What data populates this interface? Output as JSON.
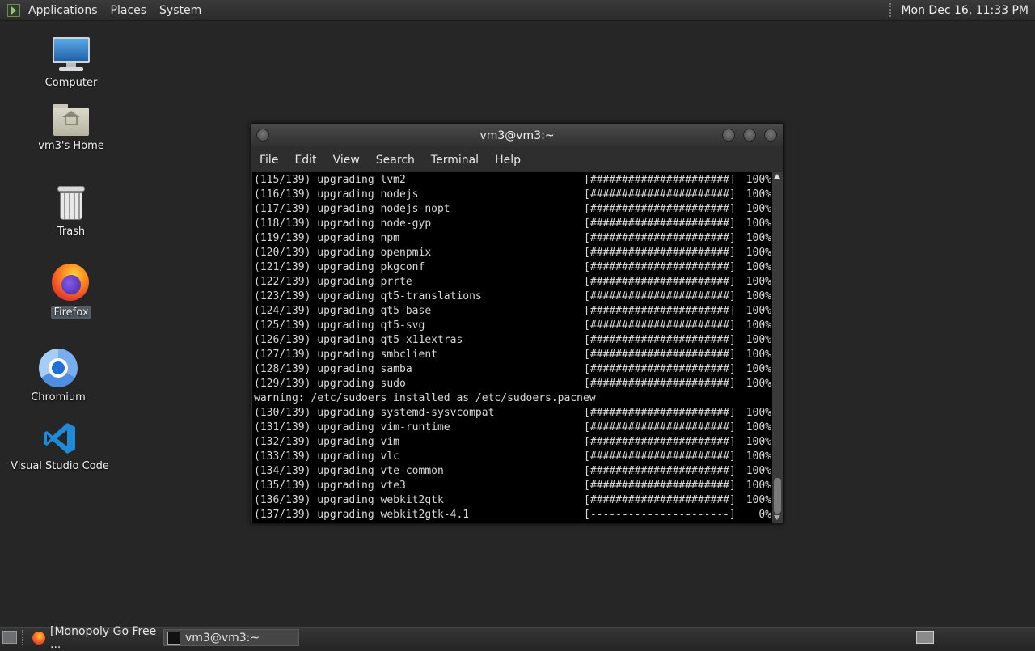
{
  "top_panel": {
    "menu": [
      "Applications",
      "Places",
      "System"
    ],
    "clock": "Mon Dec 16, 11:33 PM"
  },
  "desktop_icons": [
    {
      "label": "Computer",
      "icon": "computer-icon"
    },
    {
      "label": "vm3's Home",
      "icon": "home-folder-icon"
    },
    {
      "label": "Trash",
      "icon": "trash-icon"
    },
    {
      "label": "Firefox",
      "icon": "firefox-icon"
    },
    {
      "label": "Chromium",
      "icon": "chromium-icon"
    },
    {
      "label": "Visual Studio Code",
      "icon": "vscode-icon"
    }
  ],
  "terminal": {
    "title": "vm3@vm3:~",
    "menu": [
      "File",
      "Edit",
      "View",
      "Search",
      "Terminal",
      "Help"
    ],
    "lines": [
      {
        "text": "(115/139) upgrading lvm2",
        "bar": "[######################]",
        "pct": "100%"
      },
      {
        "text": "(116/139) upgrading nodejs",
        "bar": "[######################]",
        "pct": "100%"
      },
      {
        "text": "(117/139) upgrading nodejs-nopt",
        "bar": "[######################]",
        "pct": "100%"
      },
      {
        "text": "(118/139) upgrading node-gyp",
        "bar": "[######################]",
        "pct": "100%"
      },
      {
        "text": "(119/139) upgrading npm",
        "bar": "[######################]",
        "pct": "100%"
      },
      {
        "text": "(120/139) upgrading openpmix",
        "bar": "[######################]",
        "pct": "100%"
      },
      {
        "text": "(121/139) upgrading pkgconf",
        "bar": "[######################]",
        "pct": "100%"
      },
      {
        "text": "(122/139) upgrading prrte",
        "bar": "[######################]",
        "pct": "100%"
      },
      {
        "text": "(123/139) upgrading qt5-translations",
        "bar": "[######################]",
        "pct": "100%"
      },
      {
        "text": "(124/139) upgrading qt5-base",
        "bar": "[######################]",
        "pct": "100%"
      },
      {
        "text": "(125/139) upgrading qt5-svg",
        "bar": "[######################]",
        "pct": "100%"
      },
      {
        "text": "(126/139) upgrading qt5-x11extras",
        "bar": "[######################]",
        "pct": "100%"
      },
      {
        "text": "(127/139) upgrading smbclient",
        "bar": "[######################]",
        "pct": "100%"
      },
      {
        "text": "(128/139) upgrading samba",
        "bar": "[######################]",
        "pct": "100%"
      },
      {
        "text": "(129/139) upgrading sudo",
        "bar": "[######################]",
        "pct": "100%"
      },
      {
        "text": "warning: /etc/sudoers installed as /etc/sudoers.pacnew",
        "bar": "",
        "pct": ""
      },
      {
        "text": "(130/139) upgrading systemd-sysvcompat",
        "bar": "[######################]",
        "pct": "100%"
      },
      {
        "text": "(131/139) upgrading vim-runtime",
        "bar": "[######################]",
        "pct": "100%"
      },
      {
        "text": "(132/139) upgrading vim",
        "bar": "[######################]",
        "pct": "100%"
      },
      {
        "text": "(133/139) upgrading vlc",
        "bar": "[######################]",
        "pct": "100%"
      },
      {
        "text": "(134/139) upgrading vte-common",
        "bar": "[######################]",
        "pct": "100%"
      },
      {
        "text": "(135/139) upgrading vte3",
        "bar": "[######################]",
        "pct": "100%"
      },
      {
        "text": "(136/139) upgrading webkit2gtk",
        "bar": "[######################]",
        "pct": "100%"
      },
      {
        "text": "(137/139) upgrading webkit2gtk-4.1",
        "bar": "[----------------------]",
        "pct": "0%"
      }
    ]
  },
  "taskbar": {
    "tasks": [
      {
        "label": "[Monopoly Go Free ...",
        "icon": "firefox-icon"
      },
      {
        "label": "vm3@vm3:~",
        "icon": "terminal-icon"
      }
    ]
  }
}
